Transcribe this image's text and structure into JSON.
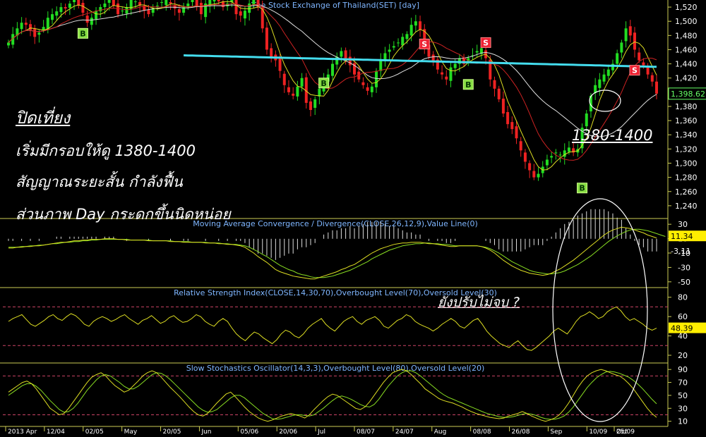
{
  "chart_data": [
    {
      "type": "candlestick",
      "title": "The Stock Exchange of Thailand(SET) [day]",
      "y_ticks": [
        1240,
        1260,
        1280,
        1300,
        1320,
        1340,
        1360,
        1380,
        1400,
        1420,
        1440,
        1460,
        1480,
        1500,
        1520
      ],
      "ylim": [
        1222,
        1530
      ],
      "last_price": "1,398.62",
      "x_labels": [
        "2013 Apr",
        "12/04",
        "02/05",
        "May",
        "20/05",
        "Jun",
        "05/06",
        "20/06",
        "Jul",
        "08/07",
        "24/07",
        "Aug",
        "08/08",
        "26/08",
        "Sep",
        "10/09",
        "25/09",
        "Oct"
      ],
      "signals": [
        {
          "type": "B",
          "label": "B",
          "index": 17,
          "price": 1483
        },
        {
          "type": "B",
          "label": "B",
          "index": 72,
          "price": 1413
        },
        {
          "type": "B",
          "label": "B",
          "index": 105,
          "price": 1411
        },
        {
          "type": "B",
          "label": "B",
          "index": 131,
          "price": 1265
        },
        {
          "type": "S",
          "label": "S",
          "index": 95,
          "price": 1468
        },
        {
          "type": "S",
          "label": "S",
          "index": 109,
          "price": 1470
        },
        {
          "type": "S",
          "label": "S",
          "index": 143,
          "price": 1431
        }
      ],
      "series": [
        {
          "name": "Close",
          "values": [
            1470,
            1482,
            1490,
            1498,
            1495,
            1488,
            1478,
            1484,
            1492,
            1505,
            1510,
            1514,
            1520,
            1518,
            1525,
            1530,
            1522,
            1512,
            1498,
            1505,
            1515,
            1520,
            1525,
            1530,
            1522,
            1510,
            1515,
            1520,
            1530,
            1528,
            1522,
            1515,
            1510,
            1518,
            1522,
            1527,
            1530,
            1525,
            1518,
            1512,
            1520,
            1525,
            1530,
            1522,
            1510,
            1525,
            1530,
            1535,
            1528,
            1520,
            1525,
            1530,
            1510,
            1508,
            1515,
            1525,
            1535,
            1520,
            1490,
            1460,
            1450,
            1445,
            1430,
            1410,
            1400,
            1395,
            1408,
            1420,
            1385,
            1375,
            1390,
            1405,
            1418,
            1425,
            1440,
            1450,
            1458,
            1448,
            1438,
            1425,
            1418,
            1410,
            1402,
            1408,
            1430,
            1445,
            1455,
            1460,
            1465,
            1470,
            1478,
            1482,
            1495,
            1500,
            1488,
            1465,
            1450,
            1442,
            1432,
            1425,
            1418,
            1435,
            1440,
            1448,
            1440,
            1448,
            1452,
            1458,
            1462,
            1448,
            1418,
            1405,
            1390,
            1370,
            1355,
            1348,
            1335,
            1318,
            1302,
            1290,
            1280,
            1285,
            1295,
            1305,
            1310,
            1315,
            1312,
            1318,
            1322,
            1315,
            1320,
            1350,
            1370,
            1395,
            1410,
            1418,
            1425,
            1432,
            1440,
            1455,
            1470,
            1490,
            1480,
            1460,
            1445,
            1438,
            1425,
            1415,
            1398
          ]
        }
      ]
    },
    {
      "type": "line",
      "title": "Moving Average Convergence / Divergence(CLOSE,26,12,9),Value Line(0)",
      "y_ticks": [
        30,
        10,
        -10,
        -30,
        -50
      ],
      "ylim": [
        -58,
        38
      ],
      "value_labels": [
        "11.34",
        "-3.11"
      ],
      "series": [
        {
          "name": "MACD",
          "values": [
            -3,
            -3,
            -2,
            -2,
            -1,
            -1,
            0,
            0,
            1,
            2,
            3,
            4,
            5,
            5,
            6,
            7,
            7,
            8,
            8,
            9,
            9,
            9,
            10,
            10,
            10,
            9,
            9,
            8,
            8,
            8,
            8,
            8,
            7,
            7,
            7,
            7,
            7,
            6,
            6,
            6,
            5,
            5,
            5,
            5,
            5,
            4,
            4,
            4,
            3,
            3,
            2,
            2,
            1,
            0,
            -2,
            -6,
            -10,
            -15,
            -19,
            -23,
            -28,
            -33,
            -36,
            -38,
            -40,
            -42,
            -43,
            -44,
            -45,
            -46,
            -46,
            -44,
            -42,
            -40,
            -38,
            -36,
            -33,
            -31,
            -28,
            -26,
            -22,
            -18,
            -14,
            -10,
            -7,
            -4,
            -2,
            0,
            2,
            3,
            4,
            4,
            5,
            5,
            5,
            4,
            3,
            3,
            2,
            1,
            0,
            -1,
            -1,
            0,
            0,
            0,
            0,
            0,
            -1,
            -3,
            -6,
            -10,
            -15,
            -20,
            -24,
            -28,
            -31,
            -34,
            -36,
            -38,
            -39,
            -40,
            -41,
            -40,
            -38,
            -35,
            -32,
            -28,
            -24,
            -20,
            -15,
            -10,
            -5,
            0,
            5,
            10,
            15,
            19,
            22,
            24,
            26,
            25,
            24,
            22,
            20,
            18,
            15,
            13,
            11
          ]
        },
        {
          "name": "Signal",
          "values": [
            -2,
            -2,
            -2,
            -1,
            -1,
            0,
            0,
            1,
            1,
            2,
            3,
            3,
            4,
            5,
            5,
            6,
            6,
            7,
            7,
            8,
            8,
            9,
            9,
            9,
            9,
            9,
            9,
            9,
            8,
            8,
            8,
            8,
            8,
            7,
            7,
            7,
            7,
            7,
            6,
            6,
            6,
            6,
            5,
            5,
            5,
            5,
            4,
            4,
            4,
            3,
            3,
            2,
            2,
            1,
            0,
            -2,
            -5,
            -8,
            -12,
            -15,
            -19,
            -23,
            -27,
            -30,
            -33,
            -35,
            -38,
            -40,
            -41,
            -43,
            -44,
            -44,
            -44,
            -43,
            -42,
            -40,
            -38,
            -36,
            -34,
            -31,
            -28,
            -25,
            -22,
            -18,
            -15,
            -12,
            -9,
            -6,
            -4,
            -2,
            0,
            1,
            2,
            3,
            3,
            4,
            4,
            3,
            3,
            2,
            2,
            1,
            0,
            0,
            0,
            0,
            0,
            0,
            -1,
            -2,
            -4,
            -7,
            -10,
            -14,
            -18,
            -22,
            -25,
            -28,
            -31,
            -34,
            -36,
            -37,
            -38,
            -39,
            -39,
            -38,
            -37,
            -35,
            -32,
            -29,
            -26,
            -22,
            -18,
            -14,
            -9,
            -4,
            1,
            6,
            10,
            14,
            17,
            20,
            22,
            23,
            23,
            22,
            21,
            19,
            17,
            15,
            13
          ]
        }
      ]
    },
    {
      "type": "line",
      "title": "Relative Strength Index(CLOSE,14,30,70),Overbought Level(70),Oversold Level(30)",
      "y_ticks": [
        80,
        60,
        40,
        20
      ],
      "ylim": [
        12,
        90
      ],
      "value_labels": [
        "48.39"
      ],
      "series": [
        {
          "name": "RSI",
          "values": [
            55,
            58,
            60,
            62,
            57,
            52,
            50,
            53,
            56,
            60,
            62,
            58,
            56,
            60,
            63,
            61,
            57,
            52,
            50,
            55,
            58,
            60,
            58,
            55,
            57,
            60,
            62,
            58,
            55,
            52,
            56,
            58,
            61,
            57,
            53,
            55,
            59,
            61,
            57,
            54,
            55,
            58,
            62,
            60,
            55,
            52,
            50,
            55,
            58,
            55,
            48,
            42,
            38,
            35,
            40,
            44,
            42,
            38,
            35,
            32,
            36,
            42,
            46,
            44,
            40,
            38,
            42,
            48,
            52,
            55,
            58,
            52,
            48,
            45,
            50,
            55,
            58,
            60,
            55,
            52,
            56,
            58,
            60,
            56,
            50,
            48,
            52,
            56,
            58,
            62,
            60,
            55,
            52,
            50,
            48,
            45,
            48,
            52,
            55,
            58,
            55,
            50,
            48,
            52,
            56,
            58,
            52,
            45,
            40,
            36,
            32,
            30,
            28,
            32,
            35,
            30,
            26,
            25,
            28,
            32,
            36,
            40,
            45,
            48,
            45,
            42,
            48,
            55,
            60,
            62,
            65,
            62,
            58,
            60,
            65,
            68,
            70,
            66,
            60,
            56,
            58,
            55,
            52,
            48,
            46,
            48
          ]
        }
      ]
    },
    {
      "type": "line",
      "title": "Slow Stochastics Oscillator(14,3,3),Overbought Level(80),Oversold Level(20)",
      "y_ticks": [
        90,
        70,
        50,
        30,
        10
      ],
      "ylim": [
        2,
        100
      ],
      "x_labels": [
        "2013 Apr",
        "12/04",
        "02/05",
        "May",
        "20/05",
        "Jun",
        "05/06",
        "20/06",
        "Jul",
        "08/07",
        "24/07",
        "Aug",
        "08/08",
        "26/08",
        "Sep",
        "10/09",
        "25/09",
        "Oct"
      ],
      "series": [
        {
          "name": "%K",
          "values": [
            55,
            60,
            65,
            70,
            72,
            68,
            60,
            50,
            40,
            30,
            25,
            20,
            22,
            30,
            40,
            50,
            60,
            70,
            78,
            82,
            85,
            80,
            72,
            65,
            60,
            55,
            58,
            65,
            72,
            80,
            85,
            88,
            85,
            78,
            70,
            62,
            55,
            48,
            40,
            32,
            25,
            20,
            18,
            22,
            30,
            38,
            45,
            52,
            55,
            48,
            40,
            32,
            25,
            20,
            15,
            12,
            10,
            12,
            15,
            18,
            20,
            22,
            20,
            18,
            15,
            20,
            28,
            35,
            42,
            48,
            52,
            50,
            45,
            40,
            35,
            30,
            28,
            32,
            40,
            50,
            60,
            70,
            78,
            85,
            88,
            90,
            88,
            82,
            75,
            68,
            60,
            55,
            50,
            45,
            42,
            40,
            38,
            35,
            32,
            28,
            25,
            22,
            20,
            18,
            16,
            15,
            14,
            15,
            18,
            20,
            22,
            25,
            22,
            18,
            15,
            12,
            10,
            12,
            15,
            20,
            28,
            38,
            50,
            62,
            72,
            80,
            85,
            88,
            90,
            88,
            85,
            82,
            80,
            75,
            68,
            60,
            50,
            40,
            30,
            22,
            16
          ]
        },
        {
          "name": "%D",
          "values": [
            50,
            55,
            60,
            65,
            68,
            68,
            64,
            58,
            50,
            42,
            35,
            28,
            24,
            25,
            30,
            38,
            48,
            58,
            66,
            74,
            80,
            82,
            80,
            75,
            70,
            64,
            60,
            60,
            64,
            70,
            76,
            82,
            85,
            84,
            80,
            74,
            67,
            60,
            53,
            46,
            39,
            32,
            27,
            24,
            25,
            28,
            34,
            40,
            46,
            50,
            50,
            46,
            40,
            34,
            28,
            22,
            18,
            14,
            13,
            14,
            16,
            18,
            20,
            20,
            19,
            18,
            20,
            25,
            30,
            36,
            42,
            47,
            49,
            47,
            44,
            40,
            36,
            33,
            32,
            36,
            44,
            54,
            64,
            72,
            80,
            85,
            88,
            88,
            85,
            80,
            74,
            68,
            62,
            56,
            51,
            47,
            44,
            41,
            38,
            35,
            32,
            29,
            26,
            23,
            21,
            19,
            17,
            16,
            16,
            17,
            19,
            21,
            22,
            21,
            19,
            16,
            14,
            13,
            13,
            15,
            18,
            24,
            32,
            42,
            52,
            62,
            70,
            77,
            82,
            86,
            87,
            86,
            84,
            81,
            78,
            73,
            67,
            60,
            52,
            44,
            37
          ]
        }
      ]
    }
  ],
  "annotations": {
    "line1": "ปิดเที่ยง",
    "line2": "เริ่มมีกรอบให้ดู 1380-1400",
    "line3": "สัญญาณระยะสั้น กำลังฟื้น",
    "line4": "ส่วนภาพ Day กระดกขึ้นนิดหน่อย",
    "range": "1380-1400",
    "rsi_note": "ยังปรับไม่จบ ?"
  },
  "colors": {
    "up": "#22dd22",
    "down": "#ee2222",
    "ma_white": "#dddddd",
    "ma_yellow": "#dddd22",
    "ma_red": "#cc2222",
    "ma_long": "#44ddee",
    "macd": "#dddd22",
    "signal": "#88dd22",
    "level": "#cc4466",
    "axis": "#cccc55",
    "title": "#7fb6ff",
    "last_price": "#66ff66",
    "label_box": "#ffee00"
  }
}
